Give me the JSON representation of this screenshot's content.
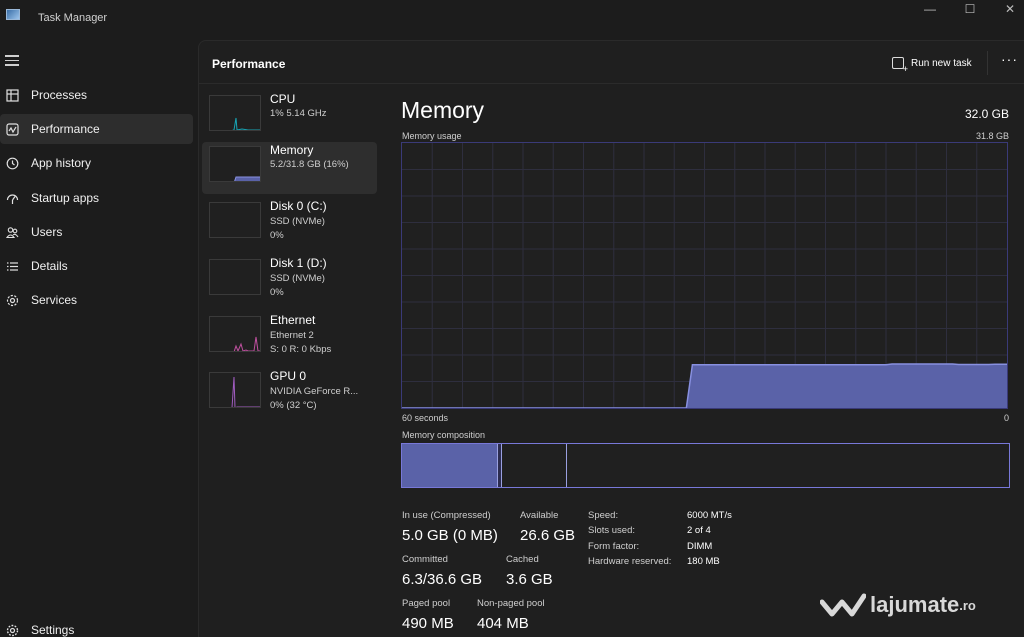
{
  "window": {
    "title": "Task Manager",
    "controls": [
      "—",
      "☐",
      "✕"
    ]
  },
  "sidebar": {
    "items": [
      {
        "label": "Processes",
        "icon": "processes-icon"
      },
      {
        "label": "Performance",
        "icon": "performance-icon",
        "active": true
      },
      {
        "label": "App history",
        "icon": "history-icon"
      },
      {
        "label": "Startup apps",
        "icon": "startup-icon"
      },
      {
        "label": "Users",
        "icon": "users-icon"
      },
      {
        "label": "Details",
        "icon": "details-icon"
      },
      {
        "label": "Services",
        "icon": "services-icon"
      }
    ],
    "settings_label": "Settings"
  },
  "header": {
    "title": "Performance",
    "run_task_label": "Run new task",
    "more_label": "···"
  },
  "devices": [
    {
      "name": "CPU",
      "sub1": "1%  5.14 GHz",
      "sub2": "",
      "color": "#17a5b5"
    },
    {
      "name": "Memory",
      "sub1": "5.2/31.8 GB (16%)",
      "sub2": "",
      "color": "#6070d0"
    },
    {
      "name": "Disk 0 (C:)",
      "sub1": "SSD (NVMe)",
      "sub2": "0%",
      "color": "#4aa86b"
    },
    {
      "name": "Disk 1 (D:)",
      "sub1": "SSD (NVMe)",
      "sub2": "0%",
      "color": "#4aa86b"
    },
    {
      "name": "Ethernet",
      "sub1": "Ethernet 2",
      "sub2": "S: 0  R: 0 Kbps",
      "color": "#c050a0"
    },
    {
      "name": "GPU 0",
      "sub1": "NVIDIA GeForce R...",
      "sub2": "0%  (32 °C)",
      "color": "#a05cc0"
    }
  ],
  "memory": {
    "title": "Memory",
    "total": "32.0 GB",
    "usage_label": "Memory usage",
    "usage_max": "31.8 GB",
    "time_label": "60 seconds",
    "zero_label": "0",
    "composition_label": "Memory composition",
    "usage_series": [
      0,
      0,
      0,
      0,
      0,
      0,
      0,
      0,
      0,
      0,
      0,
      0,
      0,
      0,
      0,
      0,
      0,
      0,
      0,
      0,
      0,
      0,
      0,
      0,
      0,
      0,
      0,
      0,
      0,
      0,
      0,
      0,
      0,
      0,
      0,
      0,
      0,
      0,
      0,
      0,
      0,
      0,
      0,
      0,
      0,
      0,
      0,
      0,
      16.3,
      16.3,
      16.3,
      16.3,
      16.3,
      16.3,
      16.3,
      16.3,
      16.3,
      16.3,
      16.3,
      16.3,
      16.3,
      16.3,
      16.3,
      16.3,
      16.3,
      16.3,
      16.3,
      16.3,
      16.3,
      16.3,
      16.3,
      16.3,
      16.3,
      16.3,
      16.3,
      16.3,
      16.3,
      16.3,
      16.3,
      16.3,
      16.3,
      16.6,
      16.6,
      16.6,
      16.6,
      16.6,
      16.6,
      16.6,
      16.6,
      16.6,
      16.6,
      16.6,
      16.4,
      16.4,
      16.4,
      16.4,
      16.4,
      16.4,
      16.5,
      16.5,
      16.5
    ],
    "stats": {
      "in_use_label": "In use (Compressed)",
      "in_use_value": "5.0 GB (0 MB)",
      "available_label": "Available",
      "available_value": "26.6 GB",
      "committed_label": "Committed",
      "committed_value": "6.3/36.6 GB",
      "cached_label": "Cached",
      "cached_value": "3.6 GB",
      "paged_label": "Paged pool",
      "paged_value": "490 MB",
      "nonpaged_label": "Non-paged pool",
      "nonpaged_value": "404 MB"
    },
    "specs": {
      "speed_label": "Speed:",
      "speed_value": "6000 MT/s",
      "slots_label": "Slots used:",
      "slots_value": "2 of 4",
      "form_label": "Form factor:",
      "form_value": "DIMM",
      "reserved_label": "Hardware reserved:",
      "reserved_value": "180 MB"
    }
  },
  "watermark": {
    "brand": "lajumate",
    "tld": ".ro"
  },
  "colors": {
    "accent": "#6070d0",
    "graph_border": "#3a3a78"
  }
}
